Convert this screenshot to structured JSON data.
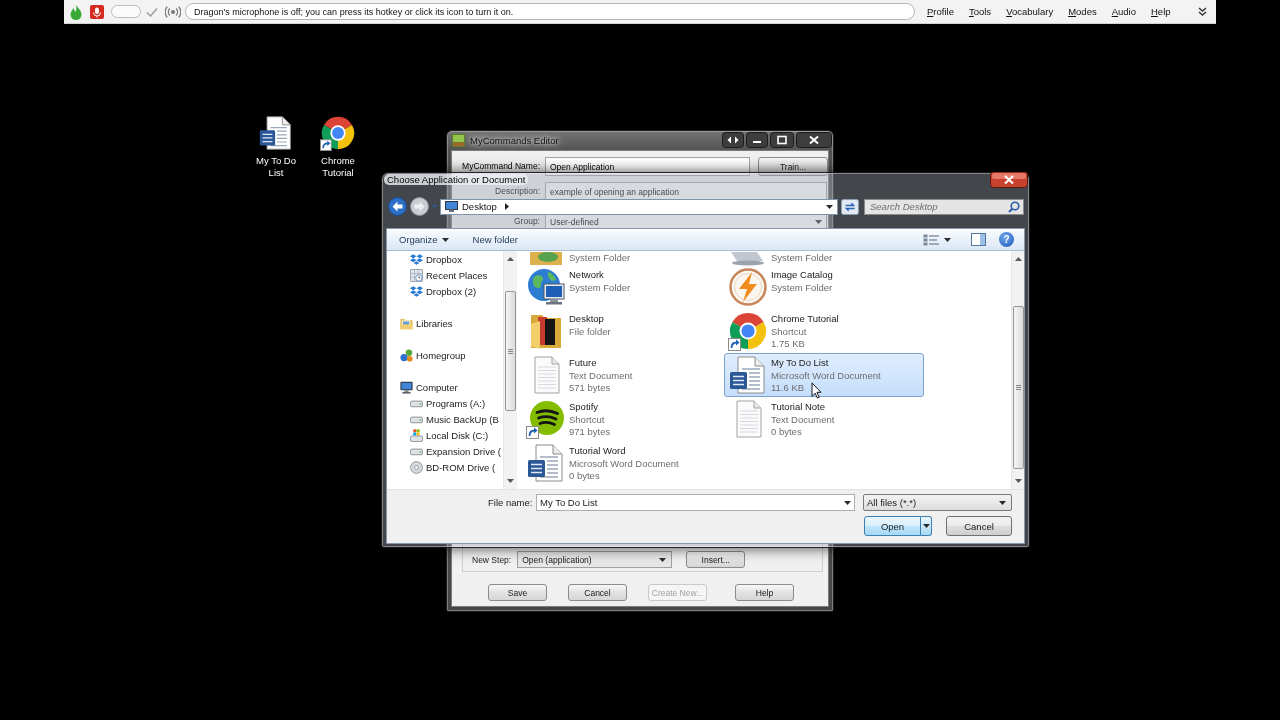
{
  "dragon_bar": {
    "volume_meter": {
      "level": 0
    },
    "message": "Dragon's microphone is off; you can press its hotkey or click its icon to turn it on.",
    "menu": [
      "Profile",
      "Tools",
      "Vocabulary",
      "Modes",
      "Audio",
      "Help"
    ]
  },
  "desktop_icons": [
    {
      "label": "My To Do List",
      "kind": "word",
      "shortcut": false
    },
    {
      "label": "Chrome Tutorial",
      "kind": "chrome",
      "shortcut": true
    }
  ],
  "mycommands_editor": {
    "title": "MyCommands Editor",
    "fields": [
      {
        "label": "MyCommand Name:",
        "value": "Open Application",
        "kind": "text",
        "button": "Train..."
      },
      {
        "label": "Description:",
        "value": "example of opening an application",
        "kind": "text"
      },
      {
        "label": "Group:",
        "value": "User-defined",
        "kind": "dropdown"
      }
    ],
    "new_step": {
      "label": "New Step:",
      "value": "Open (application)",
      "button": "Insert..."
    },
    "buttons": [
      {
        "label": "Save",
        "disabled": false
      },
      {
        "label": "Cancel",
        "disabled": false
      },
      {
        "label": "Create New...",
        "disabled": true
      },
      {
        "label": "Help",
        "disabled": false
      }
    ]
  },
  "open_dialog": {
    "title": "Choose Application or Document",
    "address": [
      "Desktop"
    ],
    "search": {
      "placeholder": "Search Desktop"
    },
    "toolbar": [
      {
        "label": "Organize",
        "kind": "menu"
      },
      {
        "label": "New folder",
        "kind": "plain"
      }
    ],
    "help_button": "?",
    "nav_pane": {
      "upper_items": [
        {
          "label": "Dropbox",
          "kind": "dropbox",
          "selected": false
        },
        {
          "label": "Recent Places",
          "kind": "recent",
          "selected": false
        },
        {
          "label": "Dropbox (2)",
          "kind": "dropbox",
          "selected": false
        }
      ],
      "tree": [
        {
          "label": "Libraries",
          "kind": "libraries",
          "selected": false
        },
        {
          "label": "Homegroup",
          "kind": "homegroup",
          "selected": false
        },
        {
          "label": "Computer",
          "kind": "computer",
          "selected": false,
          "children": [
            {
              "label": "Programs (A:)",
              "kind": "drive",
              "selected": false
            },
            {
              "label": "Music BackUp (B",
              "kind": "drive",
              "selected": false
            },
            {
              "label": "Local Disk (C:)",
              "kind": "windrive",
              "selected": false
            },
            {
              "label": "Expansion Drive (",
              "kind": "drive",
              "selected": false
            },
            {
              "label": "BD-ROM Drive (",
              "kind": "disc",
              "selected": false
            }
          ]
        }
      ]
    },
    "files": [
      {
        "kind": "userfolder",
        "details": [
          "System Folder"
        ],
        "shortcut": false,
        "selected": false
      },
      {
        "kind": "controlpanel",
        "details": [
          "System Folder"
        ],
        "shortcut": false,
        "selected": false
      },
      {
        "name": "Network",
        "kind": "network",
        "details": [
          "System Folder"
        ],
        "shortcut": false,
        "selected": false
      },
      {
        "name": "Image Catalog",
        "kind": "catalog",
        "details": [
          "System Folder"
        ],
        "shortcut": false,
        "selected": false
      },
      {
        "name": "Desktop",
        "kind": "folder",
        "details": [
          "File folder"
        ],
        "shortcut": false,
        "selected": false
      },
      {
        "name": "Chrome Tutorial",
        "kind": "chrome",
        "details": [
          "Shortcut",
          "1.75 KB"
        ],
        "shortcut": true,
        "selected": false
      },
      {
        "name": "Future",
        "kind": "text",
        "details": [
          "Text Document",
          "571 bytes"
        ],
        "shortcut": false,
        "selected": false
      },
      {
        "name": "My To Do List",
        "kind": "word",
        "details": [
          "Microsoft Word Document",
          "11.6 KB"
        ],
        "shortcut": false,
        "selected": true
      },
      {
        "name": "Spotify",
        "kind": "spotify",
        "details": [
          "Shortcut",
          "971 bytes"
        ],
        "shortcut": true,
        "selected": false
      },
      {
        "name": "Tutorial Note",
        "kind": "text",
        "details": [
          "Text Document",
          "0 bytes"
        ],
        "shortcut": false,
        "selected": false
      },
      {
        "name": "Tutorial Word",
        "kind": "word",
        "details": [
          "Microsoft Word Document",
          "0 bytes"
        ],
        "shortcut": false,
        "selected": false
      }
    ],
    "file_name": {
      "label": "File name:",
      "value": "My To Do List"
    },
    "file_type": "All files (*.*)",
    "actions": [
      {
        "label": "Open",
        "kind": "split",
        "default": true
      },
      {
        "label": "Cancel",
        "kind": "plain",
        "default": false
      }
    ]
  }
}
